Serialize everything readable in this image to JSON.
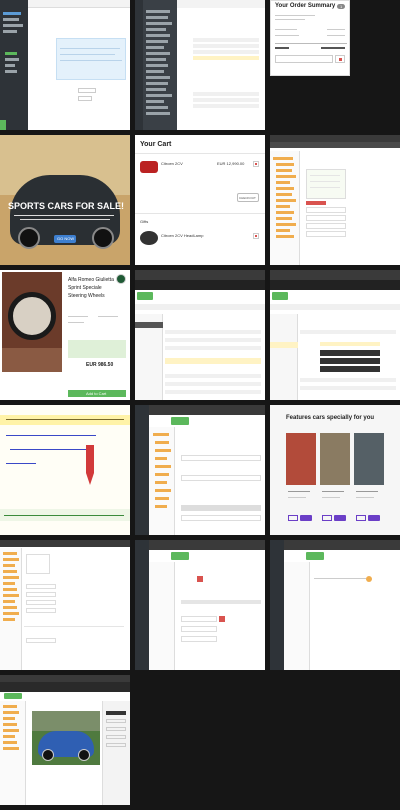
{
  "order_summary": {
    "title": "Your Order Summary",
    "badge": "1"
  },
  "promo": {
    "title": "SPORTS CARS FOR SALE!",
    "button": "GO NOW"
  },
  "cart": {
    "title": "Your Cart",
    "item_name": "Citroen 2CV",
    "item_price": "EUR 12,990.00",
    "checkout": "CHECKOUT",
    "gifts_label": "Gifts",
    "gift_name": "Citroen 2CV HeadLamp"
  },
  "product": {
    "title": "Alfa Romeo Giulietta Sprint Speciale Steering Wheels",
    "price": "EUR 986.50",
    "add_to_cart": "Add to Cart"
  },
  "featured": {
    "title": "Features cars specially for you"
  },
  "colors": {
    "cms_dark": "#2e3338",
    "green": "#5cb85c",
    "purple": "#6b3fc7",
    "highlight": "#fff3c4",
    "red": "#d9534f"
  }
}
